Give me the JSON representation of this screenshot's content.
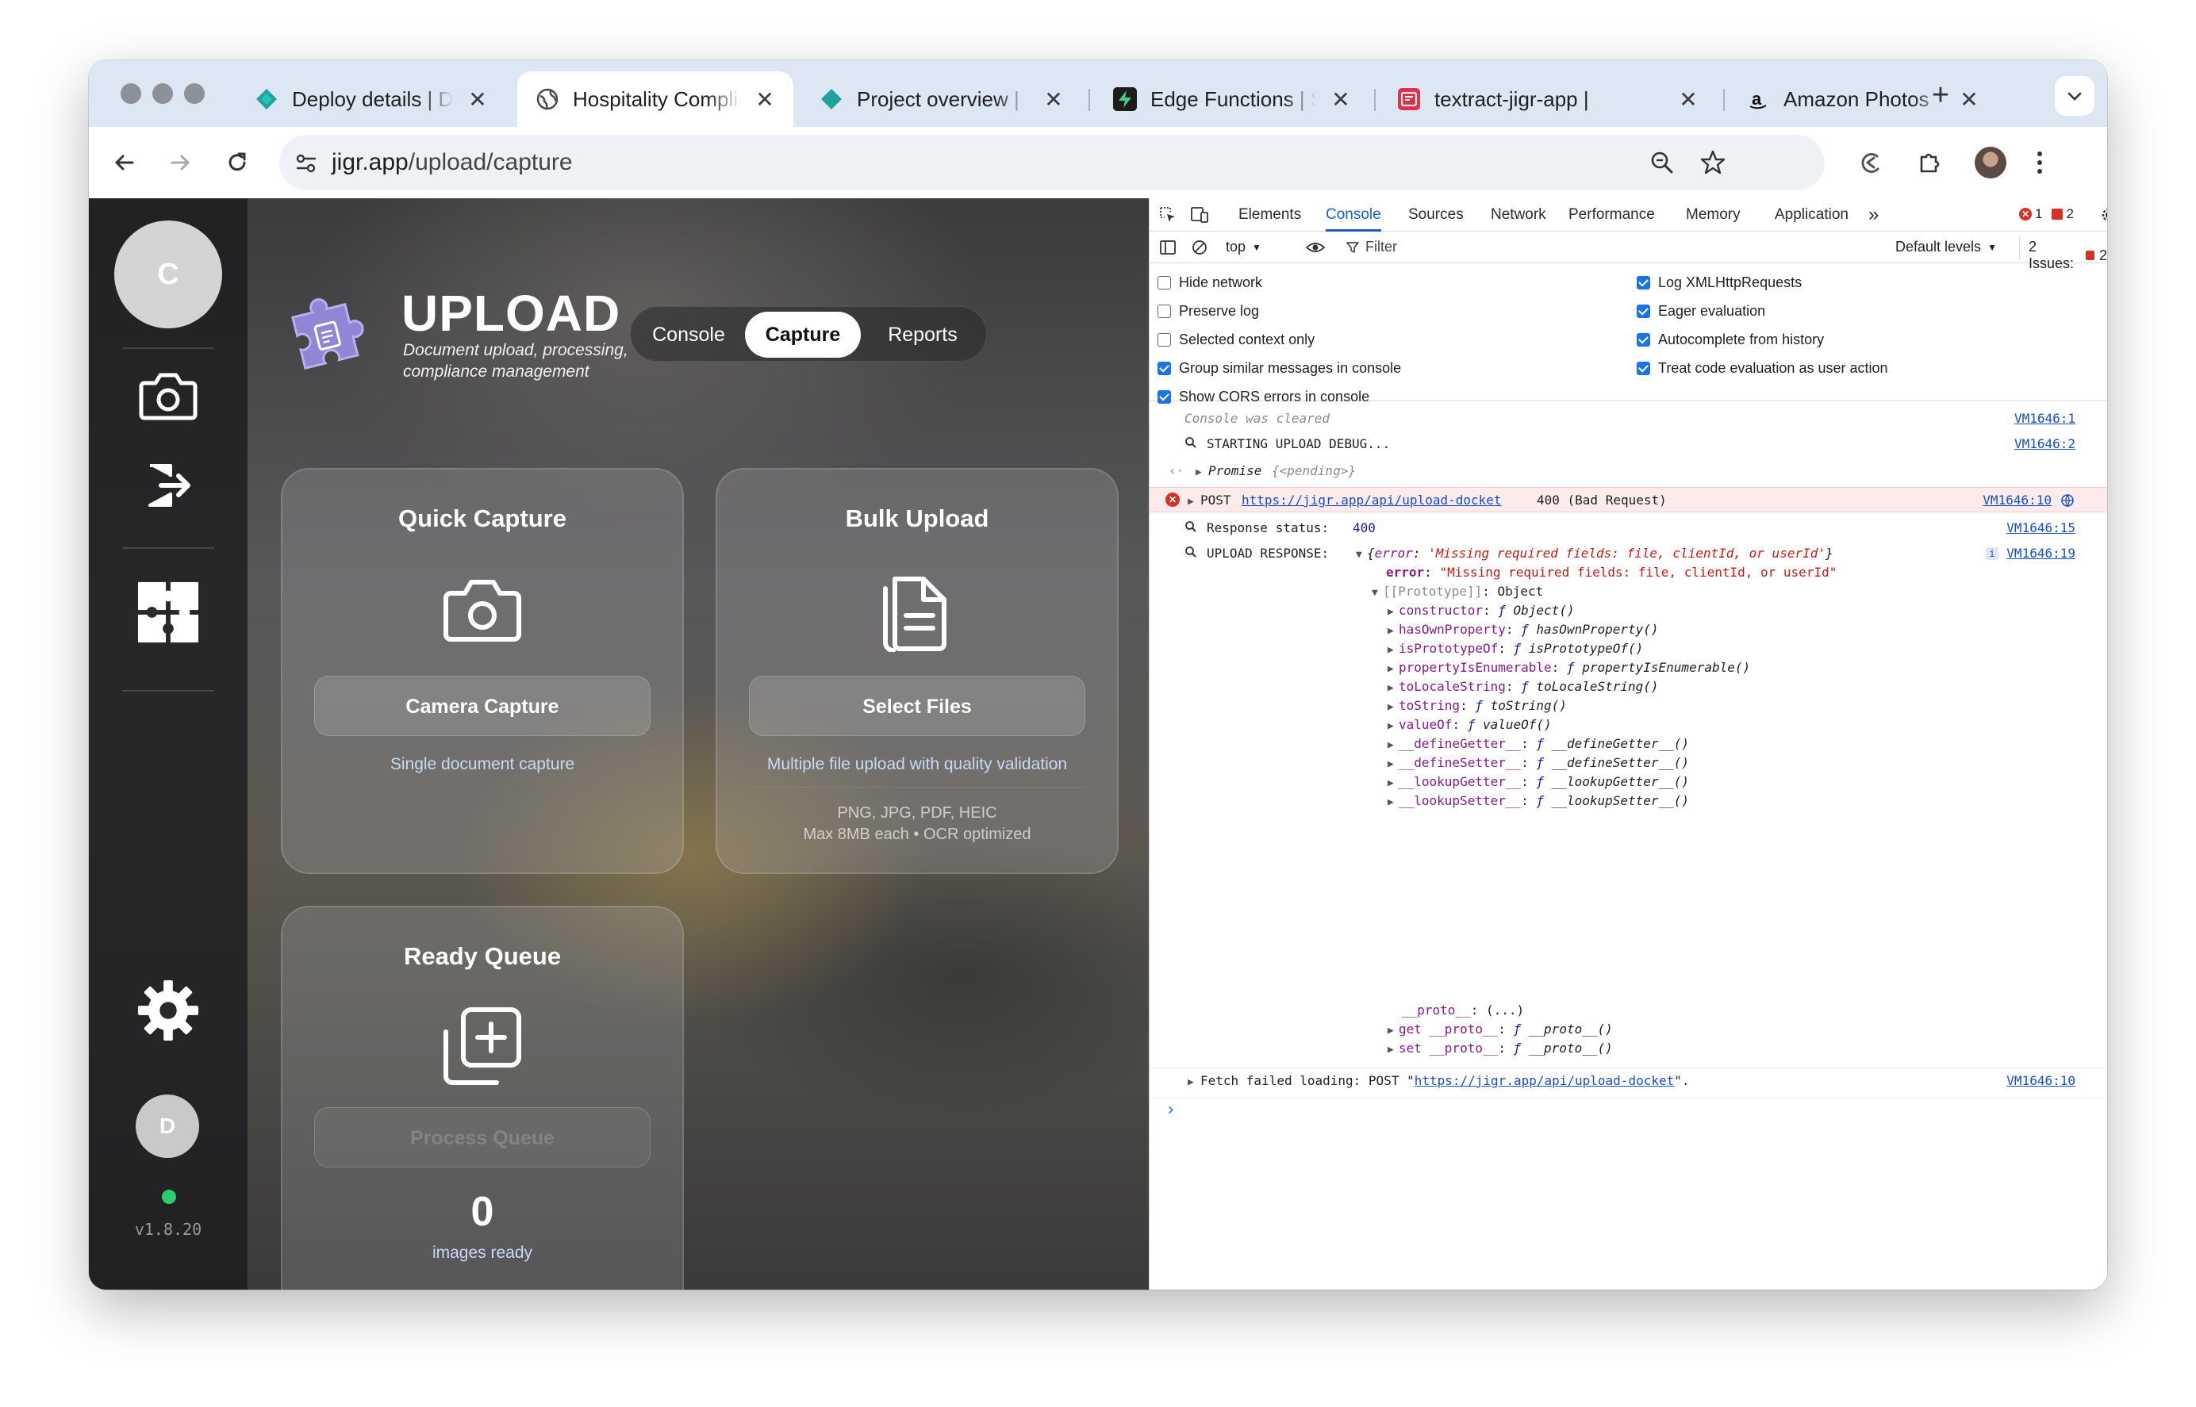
{
  "browser": {
    "tabs": [
      {
        "title": "Deploy details | De",
        "favicon": "netlify-icon",
        "active": false
      },
      {
        "title": "Hospitality Complia",
        "favicon": "globe-icon",
        "active": true
      },
      {
        "title": "Project overview | ",
        "favicon": "netlify-icon",
        "active": false
      },
      {
        "title": "Edge Functions | S",
        "favicon": "supabase-icon",
        "active": false
      },
      {
        "title": "textract-jigr-app | ",
        "favicon": "aws-icon",
        "active": false
      },
      {
        "title": "Amazon Photos",
        "favicon": "amazon-icon",
        "active": false
      }
    ],
    "tab_close_glyph": "✕",
    "new_tab_glyph": "+",
    "url_domain": "jigr.app",
    "url_path": "/upload/capture"
  },
  "app": {
    "avatar_initial": "C",
    "user_initial": "D",
    "version": "v1.8.20",
    "brand_title": "UPLOAD",
    "brand_subtitle": "Document upload, processing, compliance management",
    "nav": {
      "console": "Console",
      "capture": "Capture",
      "reports": "Reports",
      "active": "Capture"
    },
    "quick_capture": {
      "title": "Quick Capture",
      "button": "Camera Capture",
      "caption": "Single document capture"
    },
    "bulk_upload": {
      "title": "Bulk Upload",
      "button": "Select Files",
      "caption": "Multiple file upload with quality validation",
      "formats": "PNG, JPG, PDF, HEIC",
      "limits": "Max 8MB each • OCR optimized"
    },
    "ready_queue": {
      "title": "Ready Queue",
      "button": "Process Queue",
      "count": "0",
      "count_label": "images ready"
    }
  },
  "devtools": {
    "tabs": [
      "Elements",
      "Console",
      "Sources",
      "Network",
      "Performance",
      "Memory",
      "Application"
    ],
    "active_tab": "Console",
    "more_glyph": "»",
    "error_count": "1",
    "issue_count": "2",
    "context": "top",
    "filter_placeholder": "Filter",
    "levels": "Default levels",
    "issues_label": "2 Issues:",
    "issues_badge": "2",
    "settings_left": [
      {
        "label": "Hide network",
        "checked": false
      },
      {
        "label": "Preserve log",
        "checked": false
      },
      {
        "label": "Selected context only",
        "checked": false
      },
      {
        "label": "Group similar messages in console",
        "checked": true
      },
      {
        "label": "Show CORS errors in console",
        "checked": true
      }
    ],
    "settings_right": [
      {
        "label": "Log XMLHttpRequests",
        "checked": true
      },
      {
        "label": "Eager evaluation",
        "checked": true
      },
      {
        "label": "Autocomplete from history",
        "checked": true
      },
      {
        "label": "Treat code evaluation as user action",
        "checked": true
      }
    ],
    "console": {
      "cleared": "Console was cleared",
      "cleared_src": "VM1646:1",
      "debug": "STARTING UPLOAD DEBUG...",
      "debug_src": "VM1646:2",
      "promise_label": "Promise",
      "promise_value": "{<pending>}",
      "post_method": "POST",
      "post_url": "https://jigr.app/api/upload-docket",
      "post_status": "400 (Bad Request)",
      "post_src": "VM1646:10",
      "status_label": "Response status:",
      "status_value": "400",
      "status_src": "VM1646:15",
      "upload_label": "UPLOAD RESPONSE:",
      "upload_summary_key": "error",
      "upload_summary_value": "'Missing required fields: file, clientId, or userId'",
      "upload_src": "VM1646:19",
      "error_key": "error",
      "error_value": "\"Missing required fields: file, clientId, or userId\"",
      "prototype_key": "[[Prototype]]",
      "prototype_value": "Object",
      "proto_entries": [
        {
          "key": "constructor",
          "fn": "Object()"
        },
        {
          "key": "hasOwnProperty",
          "fn": "hasOwnProperty()"
        },
        {
          "key": "isPrototypeOf",
          "fn": "isPrototypeOf()"
        },
        {
          "key": "propertyIsEnumerable",
          "fn": "propertyIsEnumerable()"
        },
        {
          "key": "toLocaleString",
          "fn": "toLocaleString()"
        },
        {
          "key": "toString",
          "fn": "toString()"
        },
        {
          "key": "valueOf",
          "fn": "valueOf()"
        },
        {
          "key": "__defineGetter__",
          "fn": "__defineGetter__()"
        },
        {
          "key": "__defineSetter__",
          "fn": "__defineSetter__()"
        },
        {
          "key": "__lookupGetter__",
          "fn": "__lookupGetter__()"
        },
        {
          "key": "__lookupSetter__",
          "fn": "__lookupSetter__()"
        }
      ],
      "proto_getter": "__proto__",
      "proto_getter_value": "(...)",
      "get_proto_label": "get __proto__",
      "get_proto_fn": "__proto__()",
      "set_proto_label": "set __proto__",
      "set_proto_fn": "__proto__()",
      "fetch_prefix": "Fetch failed loading: POST \"",
      "fetch_url": "https://jigr.app/api/upload-docket",
      "fetch_suffix": "\".",
      "fetch_src": "VM1646:10",
      "prompt_glyph": "›"
    }
  }
}
